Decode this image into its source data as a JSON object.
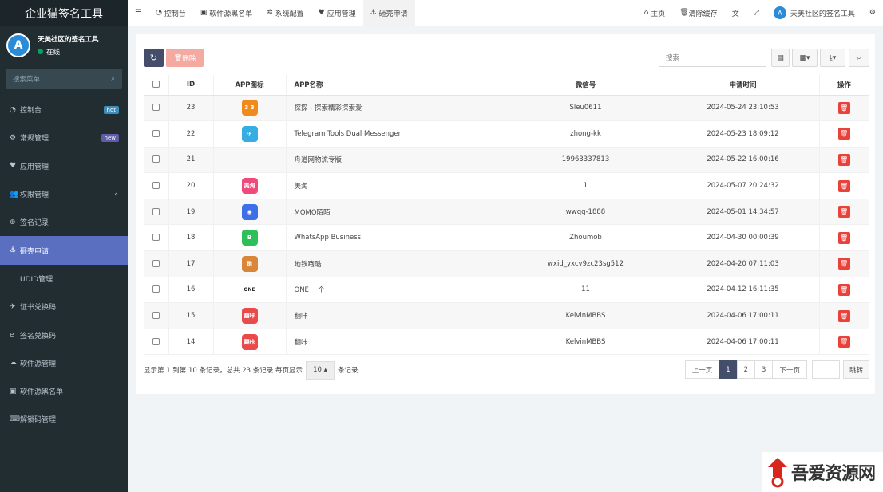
{
  "sidebar": {
    "brand": "企业猫签名工具",
    "user_name": "天美社区的签名工具",
    "status": "在线",
    "search_placeholder": "搜索菜单",
    "items": [
      {
        "label": "控制台",
        "badge": "hot",
        "icon": "dashboard-icon"
      },
      {
        "label": "常规管理",
        "badge": "new",
        "icon": "cogs-icon"
      },
      {
        "label": "应用管理",
        "icon": "heart-icon"
      },
      {
        "label": "权限管理",
        "icon": "users-icon"
      },
      {
        "label": "签名记录",
        "icon": "plus-circle-icon"
      },
      {
        "label": "砸壳申请",
        "icon": "anchor-icon",
        "active": true
      },
      {
        "label": "UDID管理",
        "icon": "apple-icon"
      },
      {
        "label": "证书兑换码",
        "icon": "paper-plane-icon"
      },
      {
        "label": "签名兑换码",
        "icon": "ie-icon"
      },
      {
        "label": "软件源管理",
        "icon": "cloud-icon"
      },
      {
        "label": "软件源黑名单",
        "icon": "book-icon"
      },
      {
        "label": "解锁码管理",
        "icon": "keyboard-icon"
      }
    ]
  },
  "topbar": {
    "tabs": [
      {
        "label": "控制台",
        "icon": "dashboard-icon"
      },
      {
        "label": "软件源黑名单",
        "icon": "book-icon"
      },
      {
        "label": "系统配置",
        "icon": "cog-icon"
      },
      {
        "label": "应用管理",
        "icon": "heart-icon"
      },
      {
        "label": "砸壳申请",
        "icon": "anchor-icon",
        "active": true
      }
    ],
    "home": "主页",
    "clear_cache": "清除缓存",
    "user": "天美社区的签名工具"
  },
  "toolbar": {
    "delete_label": "删除",
    "search_placeholder": "搜索"
  },
  "table": {
    "headers": [
      "ID",
      "APP图标",
      "APP名称",
      "微信号",
      "申请时间",
      "操作"
    ],
    "rows": [
      {
        "id": "23",
        "icon_text": "3 3",
        "icon_color": "#f08a1c",
        "name": "探探 - 探索精彩探索爱",
        "wechat": "Sleu0611",
        "time": "2024-05-24 23:10:53"
      },
      {
        "id": "22",
        "icon_text": "✈",
        "icon_color": "#37aee2",
        "name": "Telegram Tools Dual Messenger",
        "wechat": "zhong-kk",
        "time": "2024-05-23 18:09:12"
      },
      {
        "id": "21",
        "icon_text": "",
        "icon_color": "",
        "name": "舟道网物流专版",
        "wechat": "19963337813",
        "time": "2024-05-22 16:00:16"
      },
      {
        "id": "20",
        "icon_text": "美淘",
        "icon_color": "#ef4a7a",
        "name": "美淘",
        "wechat": "1",
        "time": "2024-05-07 20:24:32"
      },
      {
        "id": "19",
        "icon_text": "◉",
        "icon_color": "#3f6fe8",
        "name": "MOMO陌陌",
        "wechat": "wwqq-1888",
        "time": "2024-05-01 14:34:57"
      },
      {
        "id": "18",
        "icon_text": "B",
        "icon_color": "#2fbf5a",
        "name": "WhatsApp Business",
        "wechat": "Zhoumob",
        "time": "2024-04-30 00:00:39"
      },
      {
        "id": "17",
        "icon_text": "跑",
        "icon_color": "#d9853a",
        "name": "地铁跑酷",
        "wechat": "wxid_yxcv9zc23sg512",
        "time": "2024-04-20 07:11:03"
      },
      {
        "id": "16",
        "icon_text": "ONE",
        "icon_color": "#ffffff",
        "name": "ONE 一个",
        "wechat": "11",
        "time": "2024-04-12 16:11:35"
      },
      {
        "id": "15",
        "icon_text": "翻咔",
        "icon_color": "#ea4a4a",
        "name": "翻咔",
        "wechat": "KelvinMBBS",
        "time": "2024-04-06 17:00:11"
      },
      {
        "id": "14",
        "icon_text": "翻咔",
        "icon_color": "#ea4a4a",
        "name": "翻咔",
        "wechat": "KelvinMBBS",
        "time": "2024-04-06 17:00:11"
      }
    ]
  },
  "footer": {
    "summary": "显示第 1 到第 10 条记录，总共 23 条记录 每页显示",
    "page_size": "10",
    "records": "条记录",
    "prev": "上一页",
    "pages": [
      "1",
      "2",
      "3"
    ],
    "next": "下一页",
    "jump": "跳转"
  },
  "watermark": {
    "text": "吾爱资源网"
  }
}
